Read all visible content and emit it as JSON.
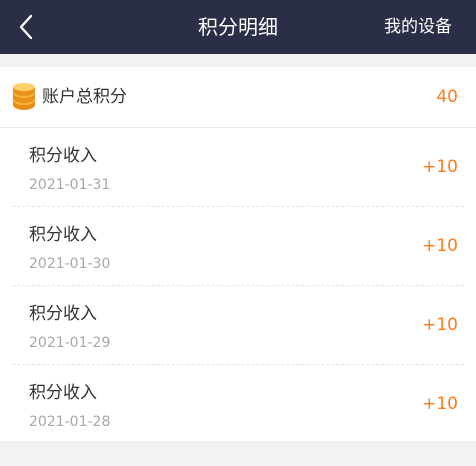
{
  "header": {
    "title": "积分明细",
    "right_action": "我的设备"
  },
  "summary": {
    "label": "账户总积分",
    "value": "40"
  },
  "records": [
    {
      "title": "积分收入",
      "date": "2021-01-31",
      "points": "+10"
    },
    {
      "title": "积分收入",
      "date": "2021-01-30",
      "points": "+10"
    },
    {
      "title": "积分收入",
      "date": "2021-01-29",
      "points": "+10"
    },
    {
      "title": "积分收入",
      "date": "2021-01-28",
      "points": "+10"
    }
  ],
  "colors": {
    "nav_bg": "#2b2e47",
    "accent": "#ff7a1a",
    "page_bg": "#f2f2f5"
  }
}
